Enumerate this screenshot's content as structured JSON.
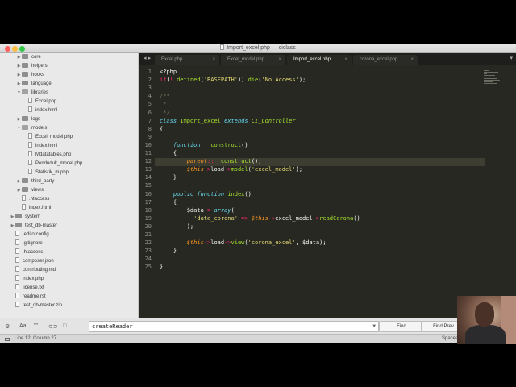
{
  "window": {
    "title": "Import_excel.php — ciclass"
  },
  "sidebar": {
    "items": [
      {
        "label": "core",
        "type": "folder",
        "indent": 2,
        "expanded": false
      },
      {
        "label": "helpers",
        "type": "folder",
        "indent": 2,
        "expanded": false
      },
      {
        "label": "hooks",
        "type": "folder",
        "indent": 2,
        "expanded": false
      },
      {
        "label": "language",
        "type": "folder",
        "indent": 2,
        "expanded": false
      },
      {
        "label": "libraries",
        "type": "folder",
        "indent": 2,
        "expanded": true
      },
      {
        "label": "Excel.php",
        "type": "file",
        "indent": 3
      },
      {
        "label": "index.html",
        "type": "file",
        "indent": 3
      },
      {
        "label": "logs",
        "type": "folder",
        "indent": 2,
        "expanded": false
      },
      {
        "label": "models",
        "type": "folder",
        "indent": 2,
        "expanded": true
      },
      {
        "label": "Excel_model.php",
        "type": "file",
        "indent": 3
      },
      {
        "label": "index.html",
        "type": "file",
        "indent": 3
      },
      {
        "label": "Mdatatables.php",
        "type": "file",
        "indent": 3
      },
      {
        "label": "Penduduk_model.php",
        "type": "file",
        "indent": 3
      },
      {
        "label": "Statistik_m.php",
        "type": "file",
        "indent": 3
      },
      {
        "label": "third_party",
        "type": "folder",
        "indent": 2,
        "expanded": false
      },
      {
        "label": "views",
        "type": "folder",
        "indent": 2,
        "expanded": false
      },
      {
        "label": ".htaccess",
        "type": "file",
        "indent": 2
      },
      {
        "label": "index.html",
        "type": "file",
        "indent": 2
      },
      {
        "label": "system",
        "type": "folder",
        "indent": 1,
        "expanded": false
      },
      {
        "label": "test_db-master",
        "type": "folder",
        "indent": 1,
        "expanded": false
      },
      {
        "label": ".editorconfig",
        "type": "file",
        "indent": 1
      },
      {
        "label": ".gitignore",
        "type": "file",
        "indent": 1
      },
      {
        "label": ".htaccess",
        "type": "file",
        "indent": 1
      },
      {
        "label": "composer.json",
        "type": "file",
        "indent": 1
      },
      {
        "label": "contributing.md",
        "type": "file",
        "indent": 1
      },
      {
        "label": "index.php",
        "type": "file",
        "indent": 1
      },
      {
        "label": "license.txt",
        "type": "file",
        "indent": 1
      },
      {
        "label": "readme.rst",
        "type": "file",
        "indent": 1
      },
      {
        "label": "test_db-master.zip",
        "type": "file",
        "indent": 1
      }
    ]
  },
  "tabs": [
    {
      "label": "Excel.php",
      "active": false
    },
    {
      "label": "Excel_model.php",
      "active": false
    },
    {
      "label": "Import_excel.php",
      "active": true
    },
    {
      "label": "corona_excel.php",
      "active": false
    }
  ],
  "editor": {
    "current_line": 12,
    "lines": [
      [
        {
          "t": "<?php",
          "c": ""
        }
      ],
      [
        {
          "t": "if",
          "c": "kw"
        },
        {
          "t": "(",
          "c": ""
        },
        {
          "t": "!",
          "c": "kw"
        },
        {
          "t": " defined",
          "c": "fn"
        },
        {
          "t": "(",
          "c": ""
        },
        {
          "t": "'BASEPATH'",
          "c": "st"
        },
        {
          "t": ")) ",
          "c": ""
        },
        {
          "t": "die",
          "c": "fn"
        },
        {
          "t": "(",
          "c": ""
        },
        {
          "t": "'No Access'",
          "c": "st"
        },
        {
          "t": ");",
          "c": ""
        }
      ],
      [],
      [
        {
          "t": "/**",
          "c": "cm"
        }
      ],
      [
        {
          "t": " *",
          "c": "cm"
        }
      ],
      [
        {
          "t": " */",
          "c": "cm"
        }
      ],
      [
        {
          "t": "class",
          "c": "sto"
        },
        {
          "t": " ",
          "c": ""
        },
        {
          "t": "Import_excel",
          "c": "fn"
        },
        {
          "t": " ",
          "c": ""
        },
        {
          "t": "extends",
          "c": "sto"
        },
        {
          "t": " ",
          "c": ""
        },
        {
          "t": "CI_Controller",
          "c": "cls"
        }
      ],
      [
        {
          "t": "{",
          "c": ""
        }
      ],
      [],
      [
        {
          "t": "    ",
          "c": ""
        },
        {
          "t": "function",
          "c": "sto"
        },
        {
          "t": " ",
          "c": ""
        },
        {
          "t": "__construct",
          "c": "fn"
        },
        {
          "t": "()",
          "c": ""
        }
      ],
      [
        {
          "t": "    {",
          "c": ""
        }
      ],
      [
        {
          "t": "        ",
          "c": ""
        },
        {
          "t": "parent",
          "c": "vr"
        },
        {
          "t": "::",
          "c": "kw"
        },
        {
          "t": "__construct",
          "c": "fn"
        },
        {
          "t": "();",
          "c": ""
        }
      ],
      [
        {
          "t": "        ",
          "c": ""
        },
        {
          "t": "$this",
          "c": "vr"
        },
        {
          "t": "->",
          "c": "kw"
        },
        {
          "t": "load",
          "c": ""
        },
        {
          "t": "->",
          "c": "kw"
        },
        {
          "t": "model",
          "c": "fn"
        },
        {
          "t": "(",
          "c": ""
        },
        {
          "t": "'excel_model'",
          "c": "st"
        },
        {
          "t": ");",
          "c": ""
        }
      ],
      [
        {
          "t": "    }",
          "c": ""
        }
      ],
      [],
      [
        {
          "t": "    ",
          "c": ""
        },
        {
          "t": "public",
          "c": "sto"
        },
        {
          "t": " ",
          "c": ""
        },
        {
          "t": "function",
          "c": "sto"
        },
        {
          "t": " ",
          "c": ""
        },
        {
          "t": "index",
          "c": "fn"
        },
        {
          "t": "()",
          "c": ""
        }
      ],
      [
        {
          "t": "    {",
          "c": ""
        }
      ],
      [
        {
          "t": "        $data ",
          "c": ""
        },
        {
          "t": "=",
          "c": "kw"
        },
        {
          "t": " ",
          "c": ""
        },
        {
          "t": "array",
          "c": "sto"
        },
        {
          "t": "(",
          "c": ""
        }
      ],
      [
        {
          "t": "          ",
          "c": ""
        },
        {
          "t": "'data_corona'",
          "c": "st"
        },
        {
          "t": " ",
          "c": ""
        },
        {
          "t": "=>",
          "c": "kw"
        },
        {
          "t": " ",
          "c": ""
        },
        {
          "t": "$this",
          "c": "vr"
        },
        {
          "t": "->",
          "c": "kw"
        },
        {
          "t": "excel_model",
          "c": ""
        },
        {
          "t": "->",
          "c": "kw"
        },
        {
          "t": "readCorona",
          "c": "fn"
        },
        {
          "t": "()",
          "c": ""
        }
      ],
      [
        {
          "t": "        );",
          "c": ""
        }
      ],
      [],
      [
        {
          "t": "        ",
          "c": ""
        },
        {
          "t": "$this",
          "c": "vr"
        },
        {
          "t": "->",
          "c": "kw"
        },
        {
          "t": "load",
          "c": ""
        },
        {
          "t": "->",
          "c": "kw"
        },
        {
          "t": "view",
          "c": "fn"
        },
        {
          "t": "(",
          "c": ""
        },
        {
          "t": "'corona_excel'",
          "c": "st"
        },
        {
          "t": ", $data);",
          "c": ""
        }
      ],
      [
        {
          "t": "    }",
          "c": ""
        }
      ],
      [],
      [
        {
          "t": "}",
          "c": ""
        }
      ]
    ]
  },
  "findbar": {
    "query": "createReader",
    "find_label": "Find",
    "find_prev_label": "Find Prev",
    "options": [
      "Aa",
      "\"\"",
      "⊂⊃",
      "□"
    ]
  },
  "statusbar": {
    "position": "Line 12, Column 27",
    "indent": "Spaces"
  }
}
